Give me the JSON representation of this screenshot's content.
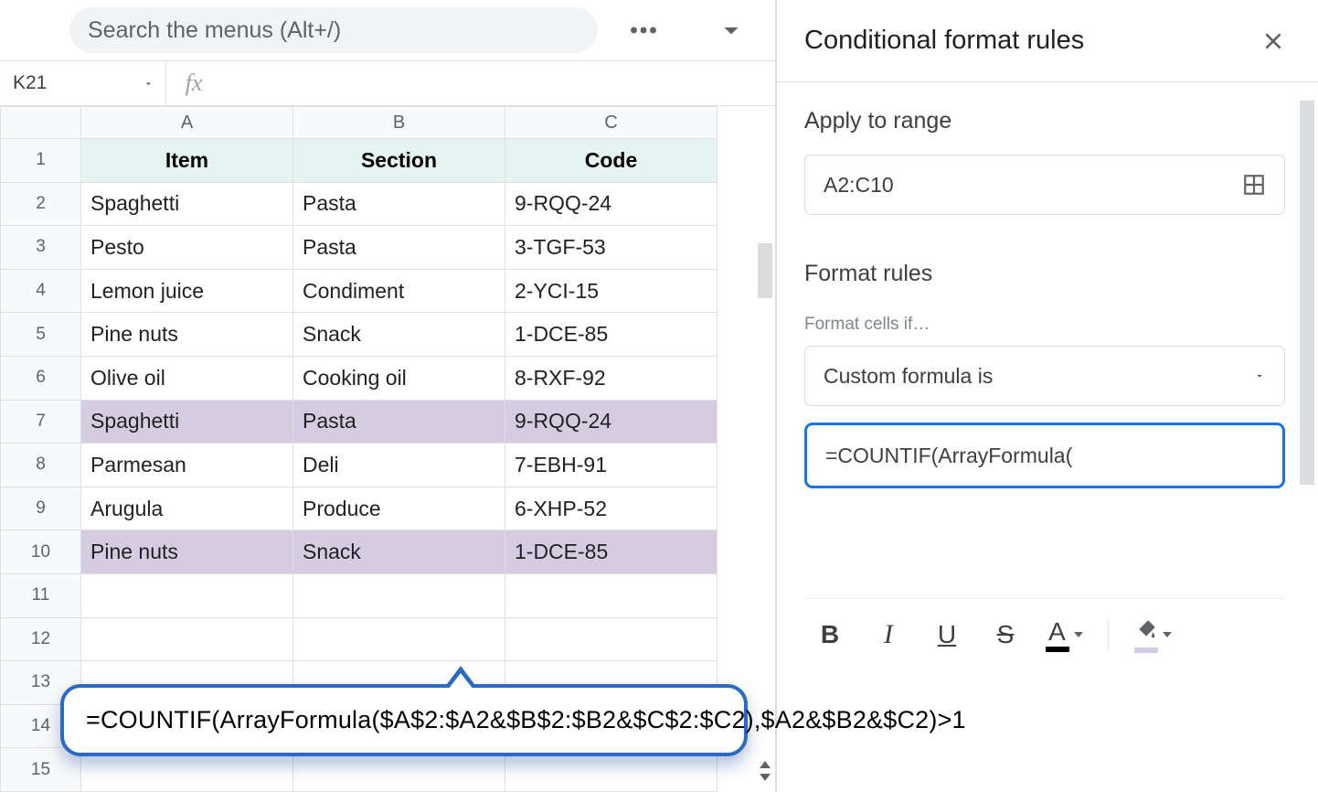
{
  "topbar": {
    "search_placeholder": "Search the menus (Alt+/)"
  },
  "namebox": {
    "value": "K21",
    "fx_label": "fx",
    "formula_value": ""
  },
  "columns": [
    "A",
    "B",
    "C"
  ],
  "headers": {
    "A": "Item",
    "B": "Section",
    "C": "Code"
  },
  "rows": [
    {
      "n": 1,
      "header": true
    },
    {
      "n": 2,
      "A": "Spaghetti",
      "B": "Pasta",
      "C": "9-RQQ-24"
    },
    {
      "n": 3,
      "A": "Pesto",
      "B": "Pasta",
      "C": "3-TGF-53"
    },
    {
      "n": 4,
      "A": "Lemon juice",
      "B": "Condiment",
      "C": "2-YCI-15"
    },
    {
      "n": 5,
      "A": "Pine nuts",
      "B": "Snack",
      "C": "1-DCE-85"
    },
    {
      "n": 6,
      "A": "Olive oil",
      "B": "Cooking oil",
      "C": "8-RXF-92"
    },
    {
      "n": 7,
      "A": "Spaghetti",
      "B": "Pasta",
      "C": "9-RQQ-24",
      "highlight": true
    },
    {
      "n": 8,
      "A": "Parmesan",
      "B": "Deli",
      "C": "7-EBH-91"
    },
    {
      "n": 9,
      "A": "Arugula",
      "B": "Produce",
      "C": "6-XHP-52"
    },
    {
      "n": 10,
      "A": "Pine nuts",
      "B": "Snack",
      "C": "1-DCE-85",
      "highlight": true
    },
    {
      "n": 11
    },
    {
      "n": 12
    },
    {
      "n": 13
    },
    {
      "n": 14
    },
    {
      "n": 15
    }
  ],
  "callout": {
    "formula": "=COUNTIF(ArrayFormula($A$2:$A2&$B$2:$B2&$C$2:$C2),$A2&$B2&$C2)>1"
  },
  "panel": {
    "title": "Conditional format rules",
    "apply_label": "Apply to range",
    "range_value": "A2:C10",
    "rules_label": "Format rules",
    "rules_hint": "Format cells if…",
    "condition_selected": "Custom formula is",
    "formula_display": "=COUNTIF(ArrayFormula(",
    "toolbar": {
      "bold": "B",
      "italic": "I",
      "underline": "U",
      "strike": "S",
      "textcolor": "A"
    }
  }
}
